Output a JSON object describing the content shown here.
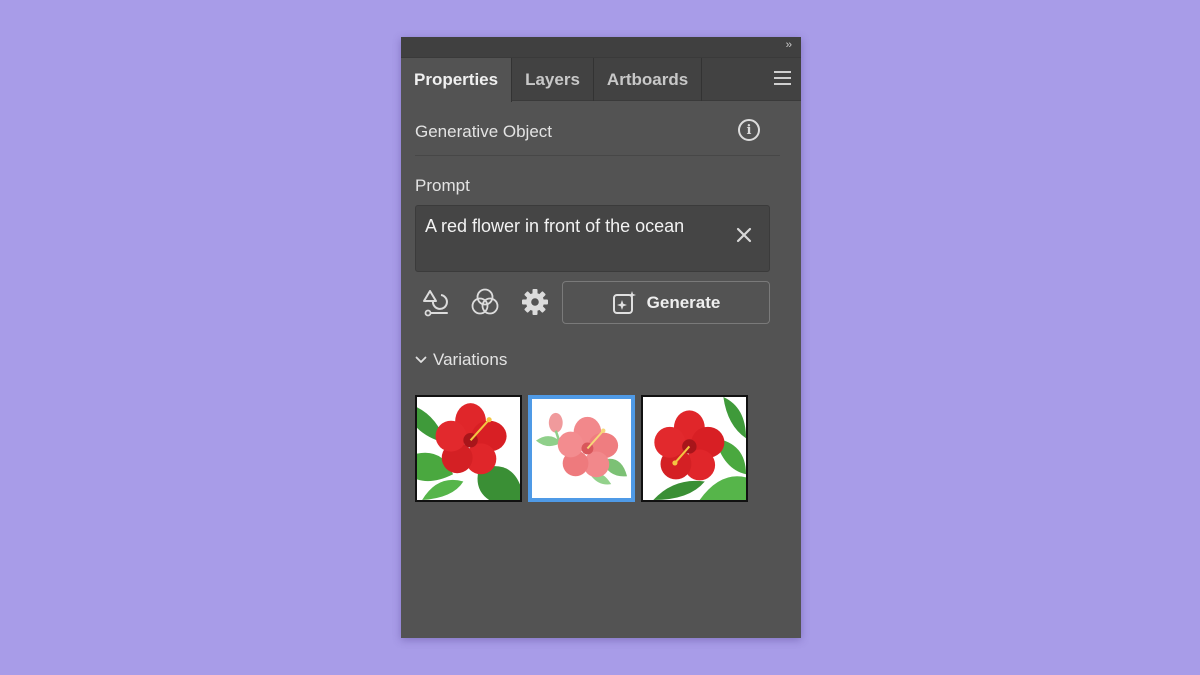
{
  "panel": {
    "tabs": [
      {
        "label": "Properties",
        "active": true
      },
      {
        "label": "Layers",
        "active": false
      },
      {
        "label": "Artboards",
        "active": false
      }
    ],
    "collapse_glyph": "››",
    "section_title": "Generative Object",
    "prompt_label": "Prompt",
    "prompt_value": "A red flower in front of the ocean",
    "toolbar_icons": [
      "shape-type-icon",
      "color-effects-icon",
      "settings-gear-icon"
    ],
    "generate_label": "Generate",
    "variations_label": "Variations",
    "variations": [
      {
        "name": "variation-1",
        "selected": false
      },
      {
        "name": "variation-2",
        "selected": true
      },
      {
        "name": "variation-3",
        "selected": false
      }
    ]
  },
  "colors": {
    "background": "#a89ce8",
    "panel": "#535353",
    "tab_bar": "#424242",
    "selected_outline": "#4f9ae6",
    "flower_red": "#e0262a"
  }
}
